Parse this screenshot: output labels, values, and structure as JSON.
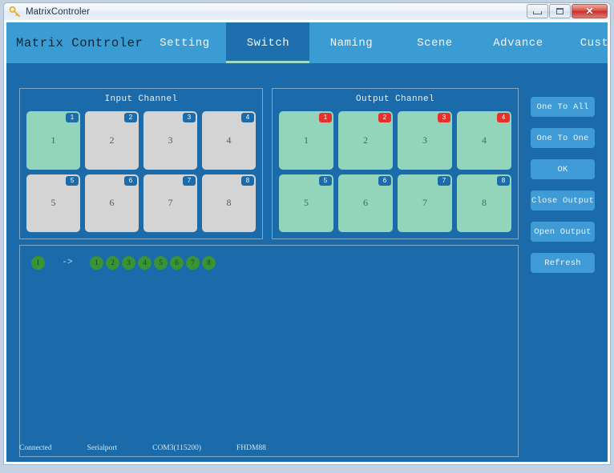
{
  "window": {
    "title": "MatrixControler",
    "icon": "key-icon",
    "minimize_label": "Minimize",
    "maximize_label": "Maximize",
    "close_label": "Close"
  },
  "header": {
    "brand": "Matrix Controler",
    "tabs": [
      {
        "label": "Setting",
        "active": false
      },
      {
        "label": "Switch",
        "active": true
      },
      {
        "label": "Naming",
        "active": false
      },
      {
        "label": "Scene",
        "active": false
      },
      {
        "label": "Advance",
        "active": false
      },
      {
        "label": "Custom",
        "active": false
      }
    ]
  },
  "input_panel": {
    "title": "Input Channel",
    "channels": [
      {
        "label": "1",
        "badge": "1",
        "selected": true,
        "badge_state": "normal"
      },
      {
        "label": "2",
        "badge": "2",
        "selected": false,
        "badge_state": "normal"
      },
      {
        "label": "3",
        "badge": "3",
        "selected": false,
        "badge_state": "normal"
      },
      {
        "label": "4",
        "badge": "4",
        "selected": false,
        "badge_state": "normal"
      },
      {
        "label": "5",
        "badge": "5",
        "selected": false,
        "badge_state": "normal"
      },
      {
        "label": "6",
        "badge": "6",
        "selected": false,
        "badge_state": "normal"
      },
      {
        "label": "7",
        "badge": "7",
        "selected": false,
        "badge_state": "normal"
      },
      {
        "label": "8",
        "badge": "8",
        "selected": false,
        "badge_state": "normal"
      }
    ]
  },
  "output_panel": {
    "title": "Output Channel",
    "channels": [
      {
        "label": "1",
        "badge": "1",
        "selected": true,
        "badge_state": "alarm"
      },
      {
        "label": "2",
        "badge": "2",
        "selected": true,
        "badge_state": "alarm"
      },
      {
        "label": "3",
        "badge": "3",
        "selected": true,
        "badge_state": "alarm"
      },
      {
        "label": "4",
        "badge": "4",
        "selected": true,
        "badge_state": "alarm"
      },
      {
        "label": "5",
        "badge": "5",
        "selected": true,
        "badge_state": "normal"
      },
      {
        "label": "6",
        "badge": "6",
        "selected": true,
        "badge_state": "normal"
      },
      {
        "label": "7",
        "badge": "7",
        "selected": true,
        "badge_state": "normal"
      },
      {
        "label": "8",
        "badge": "8",
        "selected": true,
        "badge_state": "normal"
      }
    ]
  },
  "mapping_panel": {
    "rows": [
      {
        "source": "1",
        "arrow": "->",
        "targets": [
          "1",
          "2",
          "3",
          "4",
          "5",
          "6",
          "7",
          "8"
        ]
      }
    ]
  },
  "side_buttons": [
    {
      "label": "One To All"
    },
    {
      "label": "One To One"
    },
    {
      "label": "OK"
    },
    {
      "label": "Close Output"
    },
    {
      "label": "Open Output"
    },
    {
      "label": "Refresh"
    }
  ],
  "statusbar": {
    "items": [
      "Connected",
      "Serialport",
      "COM3(115200)",
      "FHDM88"
    ]
  },
  "colors": {
    "app_background": "#1b6aa9",
    "header": "#3a9cd2",
    "active_tab": "#1d6fae",
    "active_tab_underline": "#9ddcc3",
    "channel_off": "#d4d4d4",
    "channel_on": "#93d5bb",
    "badge_normal": "#1c6cab",
    "badge_alarm": "#e8302a",
    "button": "#3f9bd6",
    "dot": "#389436"
  }
}
